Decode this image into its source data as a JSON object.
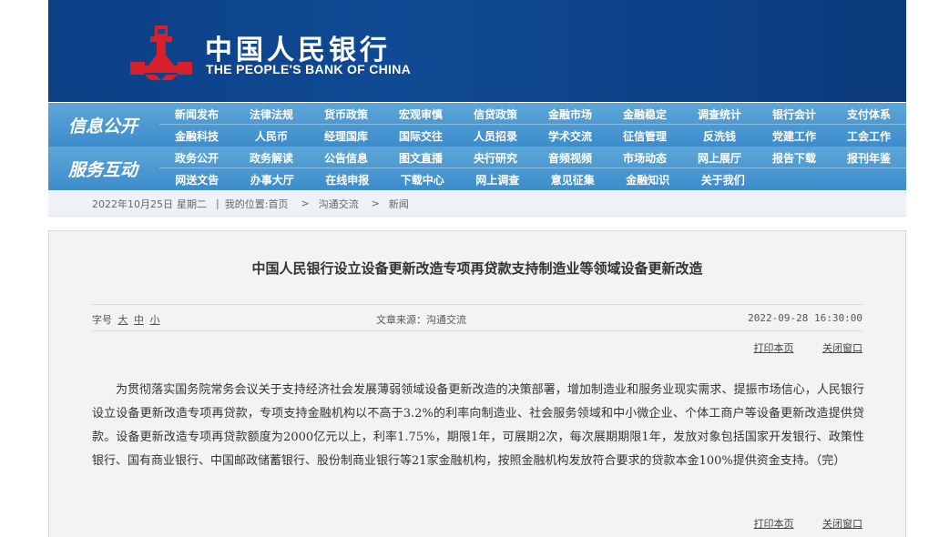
{
  "header": {
    "title_cn": "中国人民银行",
    "title_en": "THE PEOPLE'S BANK OF CHINA",
    "logo_icon": "pboc-logo-icon",
    "colors": {
      "banner": "#0f4a94",
      "logo_red": "#d8202a",
      "nav": "#4a97d0"
    }
  },
  "nav": {
    "sections": [
      {
        "label": "信息公开",
        "rows": [
          [
            "新闻发布",
            "法律法规",
            "货币政策",
            "宏观审慎",
            "信贷政策",
            "金融市场",
            "金融稳定",
            "调查统计",
            "银行会计",
            "支付体系"
          ],
          [
            "金融科技",
            "人民币",
            "经理国库",
            "国际交往",
            "人员招录",
            "学术交流",
            "征信管理",
            "反洗钱",
            "党建工作",
            "工会工作"
          ]
        ]
      },
      {
        "label": "服务互动",
        "rows": [
          [
            "政务公开",
            "政务解读",
            "公告信息",
            "图文直播",
            "央行研究",
            "音频视频",
            "市场动态",
            "网上展厅",
            "报告下载",
            "报刊年鉴"
          ],
          [
            "网送文告",
            "办事大厅",
            "在线申报",
            "下载中心",
            "网上调查",
            "意见征集",
            "金融知识",
            "关于我们"
          ]
        ]
      }
    ]
  },
  "breadcrumb": {
    "date": "2022年10月25日",
    "weekday": "星期二",
    "sep": "|",
    "location_label": "我的位置:",
    "items": [
      "首页",
      "沟通交流",
      "新闻"
    ],
    "arrow": ">"
  },
  "article": {
    "title": "中国人民银行设立设备更新改造专项再贷款支持制造业等领域设备更新改造",
    "font_size_label": "字号",
    "font_sizes": [
      "大",
      "中",
      "小"
    ],
    "source": "文章来源：沟通交流",
    "datetime": "2022-09-28 16:30:00",
    "print_label": "打印本页",
    "close_label": "关闭窗口",
    "body": "为贯彻落实国务院常务会议关于支持经济社会发展薄弱领域设备更新改造的决策部署，增加制造业和服务业现实需求、提振市场信心，人民银行设立设备更新改造专项再贷款，专项支持金融机构以不高于3.2%的利率向制造业、社会服务领域和中小微企业、个体工商户等设备更新改造提供贷款。设备更新改造专项再贷款额度为2000亿元以上，利率1.75%，期限1年，可展期2次，每次展期期限1年，发放对象包括国家开发银行、政策性银行、国有商业银行、中国邮政储蓄银行、股份制商业银行等21家金融机构，按照金融机构发放符合要求的贷款本金100%提供资金支持。（完）"
  }
}
